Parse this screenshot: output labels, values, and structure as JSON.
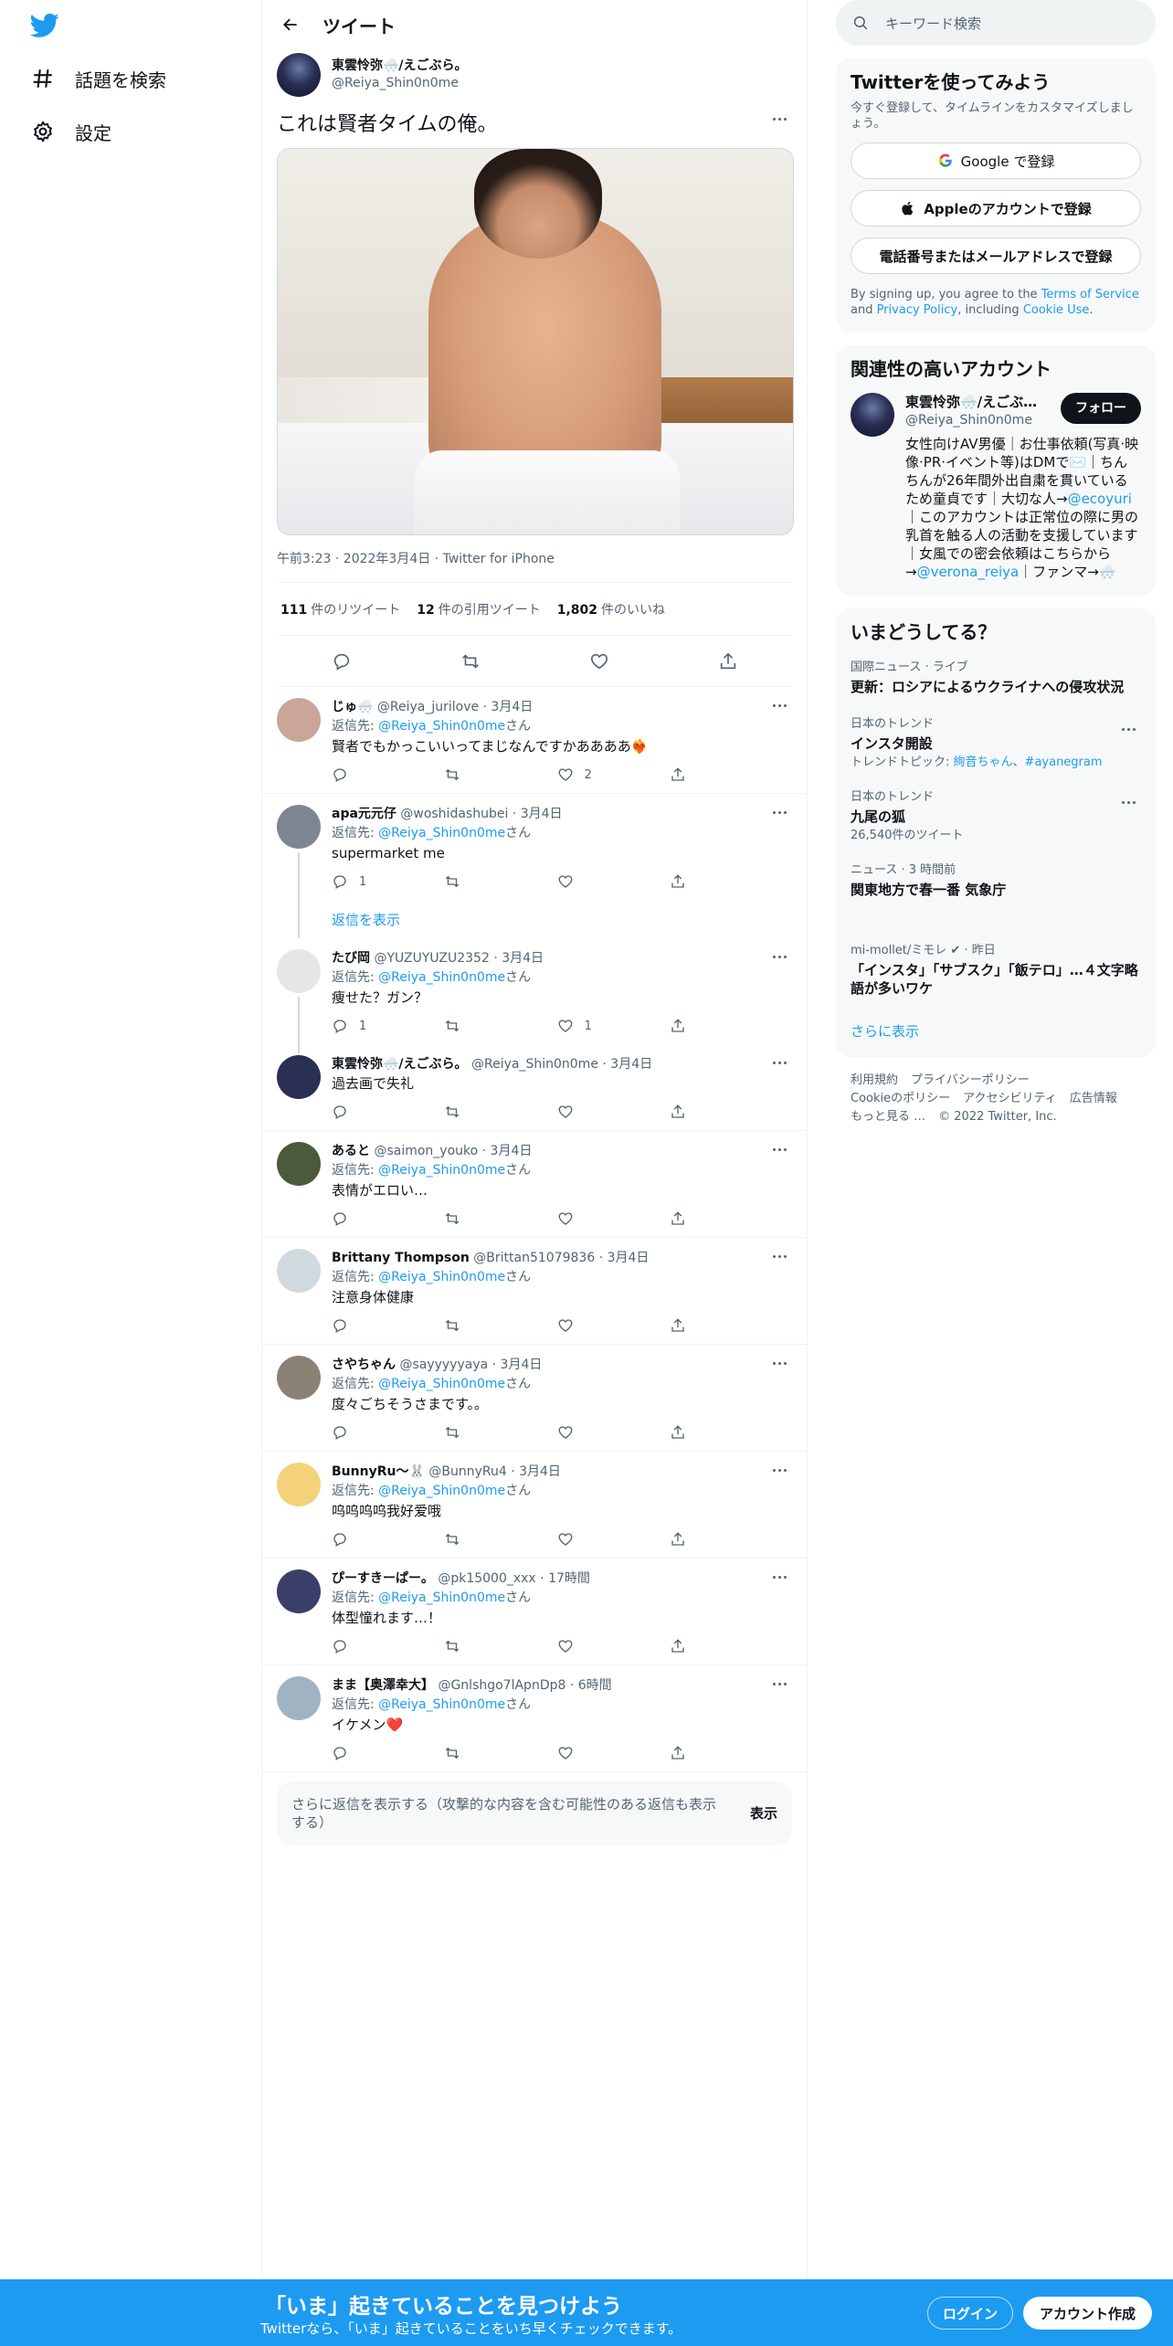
{
  "nav": {
    "items": [
      {
        "label": "話題を検索",
        "icon": "hashtag-icon"
      },
      {
        "label": "設定",
        "icon": "gear-icon"
      }
    ]
  },
  "header": {
    "title": "ツイート"
  },
  "tweet": {
    "name": "東雲怜弥🌨️/えごぶら。",
    "handle": "@Reiya_Shin0n0me",
    "text": "これは賢者タイムの俺。",
    "meta": "午前3:23 · 2022年3月4日 · Twitter for iPhone",
    "retweets": "111",
    "retweets_label": "件のリツイート",
    "quotes": "12",
    "quotes_label": "件の引用ツイート",
    "likes": "1,802",
    "likes_label": "件のいいね"
  },
  "replies": [
    {
      "name": "じゅ🌨️",
      "handle": "@Reiya_jurilove",
      "time": "· 3月4日",
      "reply_to": "@Reiya_Shin0n0me",
      "text": "賢者でもかっこいいってまじなんですかああああ❤️‍🔥",
      "reply": "",
      "retweet": "",
      "like": "2",
      "avatar": "#c9a59a"
    },
    {
      "name": "apa元元仔",
      "handle": "@woshidashubei",
      "time": "· 3月4日",
      "reply_to": "@Reiya_Shin0n0me",
      "text": "supermarket me",
      "reply": "1",
      "retweet": "",
      "like": "",
      "avatar": "#7d8591",
      "show_replies": "返信を表示"
    },
    {
      "name": "たび岡",
      "handle": "@YUZUYUZU2352",
      "time": "· 3月4日",
      "reply_to": "@Reiya_Shin0n0me",
      "text": "痩せた？ガン？",
      "reply": "1",
      "retweet": "",
      "like": "1",
      "avatar": "#e6e6e6"
    },
    {
      "name": "東雲怜弥🌨️/えごぶら。",
      "handle": "@Reiya_Shin0n0me",
      "time": "· 3月4日",
      "reply_to": "",
      "text": "過去画で失礼",
      "reply": "",
      "retweet": "",
      "like": "",
      "avatar": "#2a2f54"
    },
    {
      "name": "あると",
      "handle": "@saimon_youko",
      "time": "· 3月4日",
      "reply_to": "@Reiya_Shin0n0me",
      "text": "表情がエロい…",
      "reply": "",
      "retweet": "",
      "like": "",
      "avatar": "#4a5a3a"
    },
    {
      "name": "Brittany Thompson",
      "handle": "@Brittan51079836",
      "time": "· 3月4日",
      "reply_to": "@Reiya_Shin0n0me",
      "text": "注意身体健康",
      "reply": "",
      "retweet": "",
      "like": "",
      "avatar": "#cfd9de"
    },
    {
      "name": "さやちゃん",
      "handle": "@sayyyyyaya",
      "time": "· 3月4日",
      "reply_to": "@Reiya_Shin0n0me",
      "text": "度々ごちそうさまです。。",
      "reply": "",
      "retweet": "",
      "like": "",
      "avatar": "#8b8175"
    },
    {
      "name": "BunnyRu～🐰",
      "handle": "@BunnyRu4",
      "time": "· 3月4日",
      "reply_to": "@Reiya_Shin0n0me",
      "text": "呜呜呜呜我好爱哦",
      "reply": "",
      "retweet": "",
      "like": "",
      "avatar": "#f3d27a"
    },
    {
      "name": "ぴーすきーぱー。",
      "handle": "@pk15000_xxx",
      "time": "· 17時間",
      "reply_to": "@Reiya_Shin0n0me",
      "text": "体型憧れます…！",
      "reply": "",
      "retweet": "",
      "like": "",
      "avatar": "#3a3f6a"
    },
    {
      "name": "まま【奥澤幸大】",
      "handle": "@Gnlshgo7lApnDp8",
      "time": "· 6時間",
      "reply_to": "@Reiya_Shin0n0me",
      "text": "イケメン❤️",
      "reply": "",
      "retweet": "",
      "like": "",
      "avatar": "#9fb3c2"
    }
  ],
  "reply_to_prefix": "返信先: ",
  "reply_to_suffix": "さん",
  "more_replies": {
    "text": "さらに返信を表示する（攻撃的な内容を含む可能性のある返信も表示する）",
    "button": "表示"
  },
  "search": {
    "placeholder": "キーワード検索"
  },
  "signup": {
    "title": "Twitterを使ってみよう",
    "subtitle": "今すぐ登録して、タイムラインをカスタマイズしましょう。",
    "google": "Google で登録",
    "apple": "Appleのアカウントで登録",
    "phone": "電話番号またはメールアドレスで登録",
    "terms_a": "By signing up, you agree to the ",
    "tos": "Terms of Service",
    "terms_b": " and ",
    "privacy": "Privacy Policy",
    "terms_c": ", including ",
    "cookie": "Cookie Use",
    "terms_d": "."
  },
  "related": {
    "title": "関連性の高いアカウント",
    "name": "東雲怜弥🌨️/えごぶ…",
    "handle": "@Reiya_Shin0n0me",
    "follow": "フォロー",
    "bio_a": "女性向けAV男優｜お仕事依頼(写真·映像·PR·イベント等)はDMで✉️｜ちんちんが26年間外出自粛を貫いているため童貞です｜大切な人→",
    "bio_link1": "@ecoyuri",
    "bio_b": "｜このアカウントは正常位の際に男の乳首を触る人の活動を支援しています｜女風での密会依頼はこちらから→",
    "bio_link2": "@verona_reiya",
    "bio_c": "｜ファンマ→🌨️"
  },
  "trends": {
    "title": "いまどうしてる？",
    "items": [
      {
        "context": "国際ニュース · ライブ",
        "title": "更新：ロシアによるウクライナへの侵攻状況",
        "extra": "",
        "more": false
      },
      {
        "context": "日本のトレンド",
        "title": "インスタ開設",
        "extra_a": "トレンドトピック: ",
        "extra_link": "絢音ちゃん",
        "extra_b": "、",
        "extra_link2": "#ayanegram",
        "more": true
      },
      {
        "context": "日本のトレンド",
        "title": "九尾の狐",
        "extra": "26,540件のツイート",
        "more": true
      },
      {
        "context": "ニュース · 3 時間前",
        "title": "関東地方で春一番 気象庁",
        "extra": "",
        "more": false
      },
      {
        "context": "mi-mollet/ミモレ ✔ · 昨日",
        "title": "「インスタ」「サブスク」「飯テロ」…４文字略語が多いワケ",
        "extra": "",
        "more": false
      }
    ],
    "show_more": "さらに表示"
  },
  "footer": {
    "links": [
      "利用規約",
      "プライバシーポリシー",
      "Cookieのポリシー",
      "アクセシビリティ",
      "広告情報",
      "もっと見る …"
    ],
    "copyright": "© 2022 Twitter, Inc."
  },
  "bottom": {
    "headline": "「いま」起きていることを見つけよう",
    "sub": "Twitterなら、「いま」起きていることをいち早くチェックできます。",
    "login": "ログイン",
    "signup": "アカウント作成"
  },
  "colors": {
    "accent": "#1d9bf0",
    "text": "#0f1419",
    "muted": "#536471"
  }
}
